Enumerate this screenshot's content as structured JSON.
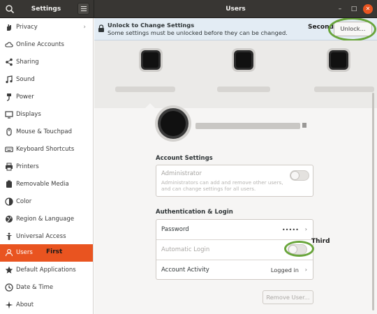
{
  "header": {
    "left_title": "Settings",
    "center_title": "Users",
    "controls": {
      "minimize": "–",
      "maximize": "□",
      "close": "✕"
    }
  },
  "sidebar": {
    "items": [
      {
        "label": "Privacy",
        "icon": "hand-icon",
        "chevron": "›"
      },
      {
        "label": "Online Accounts",
        "icon": "cloud-icon"
      },
      {
        "label": "Sharing",
        "icon": "share-icon"
      },
      {
        "label": "Sound",
        "icon": "music-note-icon"
      },
      {
        "label": "Power",
        "icon": "power-icon"
      },
      {
        "label": "Displays",
        "icon": "display-icon"
      },
      {
        "label": "Mouse & Touchpad",
        "icon": "mouse-icon"
      },
      {
        "label": "Keyboard Shortcuts",
        "icon": "keyboard-icon"
      },
      {
        "label": "Printers",
        "icon": "printer-icon"
      },
      {
        "label": "Removable Media",
        "icon": "media-icon"
      },
      {
        "label": "Color",
        "icon": "palette-icon"
      },
      {
        "label": "Region & Language",
        "icon": "globe-icon"
      },
      {
        "label": "Universal Access",
        "icon": "accessibility-icon"
      },
      {
        "label": "Users",
        "icon": "users-icon",
        "active": true,
        "annotation": "First"
      },
      {
        "label": "Default Applications",
        "icon": "star-icon"
      },
      {
        "label": "Date & Time",
        "icon": "clock-icon"
      },
      {
        "label": "About",
        "icon": "plus-icon"
      }
    ]
  },
  "infobar": {
    "title": "Unlock to Change Settings",
    "subtitle": "Some settings must be unlocked before they can be changed.",
    "annotation": "Second",
    "unlock_label": "Unlock..."
  },
  "account_settings": {
    "heading": "Account Settings",
    "administrator_label": "Administrator",
    "administrator_desc": "Administrators can add and remove other users, and can change settings for all users.",
    "administrator_enabled": false
  },
  "auth": {
    "heading": "Authentication & Login",
    "password_label": "Password",
    "password_value": "•••••",
    "auto_login_label": "Automatic Login",
    "auto_login_enabled": false,
    "auto_login_annotation": "Third",
    "activity_label": "Account Activity",
    "activity_value": "Logged in",
    "chevron": "›"
  },
  "remove_user_label": "Remove User...",
  "colors": {
    "accent": "#e95420",
    "headerbar": "#383633",
    "annotation_ring": "#69a53b",
    "infobar": "#e3ecf4"
  }
}
